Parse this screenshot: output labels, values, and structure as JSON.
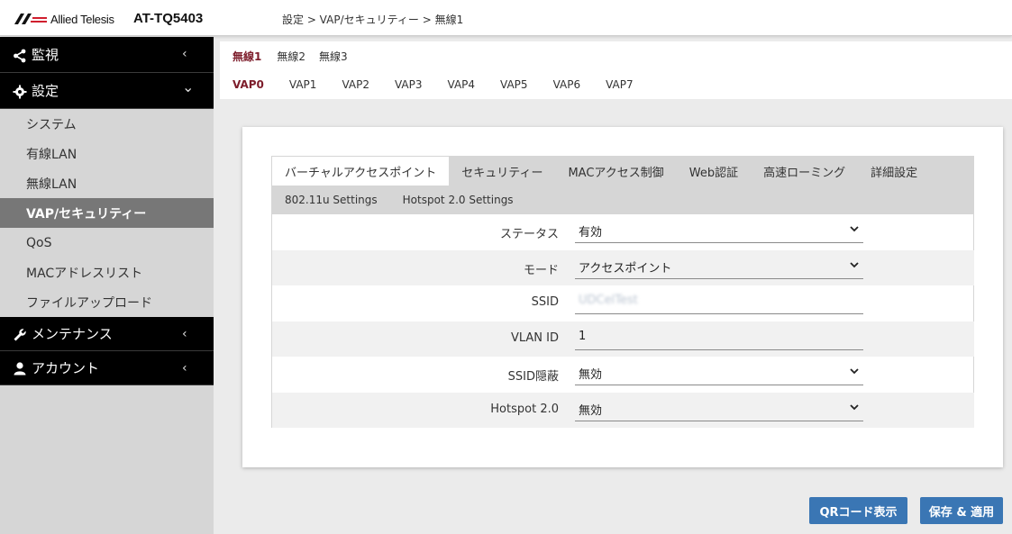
{
  "header": {
    "logo_text": "Allied Telesis",
    "model": "AT-TQ5403",
    "breadcrumb": "設定 > VAP/セキュリティー > 無線1"
  },
  "sidebar": {
    "sections": [
      {
        "label": "監視",
        "icon": "share-icon",
        "chevron": "‹"
      },
      {
        "label": "設定",
        "icon": "gear-icon",
        "chevron": "⌄"
      }
    ],
    "items": [
      {
        "label": "システム"
      },
      {
        "label": "有線LAN"
      },
      {
        "label": "無線LAN"
      },
      {
        "label": "VAP/セキュリティー",
        "active": true
      },
      {
        "label": "QoS"
      },
      {
        "label": "MACアドレスリスト"
      },
      {
        "label": "ファイルアップロード"
      }
    ],
    "bottom_sections": [
      {
        "label": "メンテナンス",
        "icon": "wrench-icon",
        "chevron": "‹"
      },
      {
        "label": "アカウント",
        "icon": "user-icon",
        "chevron": "‹"
      }
    ]
  },
  "radio_tabs": [
    {
      "label": "無線1",
      "active": true
    },
    {
      "label": "無線2"
    },
    {
      "label": "無線3"
    }
  ],
  "vap_tabs": [
    {
      "label": "VAP0",
      "active": true
    },
    {
      "label": "VAP1"
    },
    {
      "label": "VAP2"
    },
    {
      "label": "VAP3"
    },
    {
      "label": "VAP4"
    },
    {
      "label": "VAP5"
    },
    {
      "label": "VAP6"
    },
    {
      "label": "VAP7"
    }
  ],
  "sub_tabs_row1": [
    {
      "label": "バーチャルアクセスポイント",
      "active": true
    },
    {
      "label": "セキュリティー"
    },
    {
      "label": "MACアクセス制御"
    },
    {
      "label": "Web認証"
    },
    {
      "label": "高速ローミング"
    },
    {
      "label": "詳細設定"
    }
  ],
  "sub_tabs_row2": [
    {
      "label": "802.11u Settings"
    },
    {
      "label": "Hotspot 2.0 Settings"
    }
  ],
  "form": {
    "status": {
      "label": "ステータス",
      "value": "有効"
    },
    "mode": {
      "label": "モード",
      "value": "アクセスポイント"
    },
    "ssid": {
      "label": "SSID",
      "value": "UDCelTest"
    },
    "vlan_id": {
      "label": "VLAN ID",
      "value": "1"
    },
    "ssid_hidden": {
      "label": "SSID隠蔽",
      "value": "無効"
    },
    "hotspot": {
      "label": "Hotspot 2.0",
      "value": "無効"
    }
  },
  "buttons": {
    "qr": "QRコード表示",
    "save": "保存 & 適用"
  },
  "colors": {
    "accent_tab": "#7d1d2b",
    "button": "#3a76b4",
    "sidebar_active": "#777777"
  }
}
